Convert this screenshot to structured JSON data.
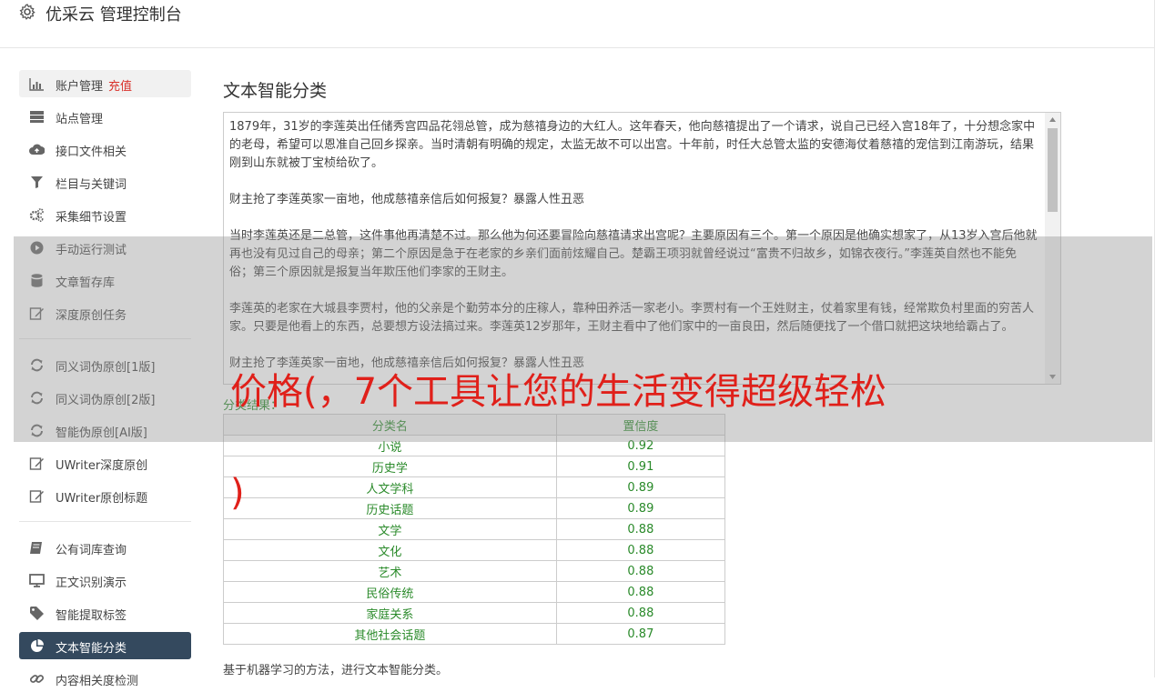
{
  "app": {
    "title": "优采云 管理控制台"
  },
  "sidebar": {
    "items": [
      {
        "label": "账户管理",
        "badge": "充值",
        "icon": "bar-chart-icon"
      },
      {
        "label": "站点管理",
        "icon": "server-icon"
      },
      {
        "label": "接口文件相关",
        "icon": "cloud-upload-icon"
      },
      {
        "label": "栏目与关键词",
        "icon": "filter-icon"
      },
      {
        "label": "采集细节设置",
        "icon": "gears-icon"
      },
      {
        "label": "手动运行测试",
        "icon": "play-circle-icon"
      },
      {
        "label": "文章暂存库",
        "icon": "database-icon"
      },
      {
        "label": "深度原创任务",
        "icon": "edit-icon"
      },
      {
        "label": "同义词伪原创[1版]",
        "icon": "refresh-icon"
      },
      {
        "label": "同义词伪原创[2版]",
        "icon": "refresh-icon"
      },
      {
        "label": "智能伪原创[AI版]",
        "icon": "refresh-icon"
      },
      {
        "label": "UWriter深度原创",
        "icon": "edit-icon"
      },
      {
        "label": "UWriter原创标题",
        "icon": "edit-icon"
      },
      {
        "label": "公有词库查询",
        "icon": "book-icon"
      },
      {
        "label": "正文识别演示",
        "icon": "monitor-icon"
      },
      {
        "label": "智能提取标签",
        "icon": "tag-icon"
      },
      {
        "label": "文本智能分类",
        "icon": "pie-chart-icon"
      },
      {
        "label": "内容相关度检测",
        "icon": "link-icon"
      }
    ]
  },
  "main": {
    "title": "文本智能分类",
    "text_paragraphs": [
      "1879年，31岁的李莲英出任储秀宫四品花翎总管，成为慈禧身边的大红人。这年春天，他向慈禧提出了一个请求，说自己已经入宫18年了，十分想念家中的老母，希望可以恩准自己回乡探亲。当时清朝有明确的规定，太监无故不可以出宫。十年前，时任大总管太监的安德海仗着慈禧的宠信到江南游玩，结果刚到山东就被丁宝桢给砍了。",
      "财主抢了李莲英家一亩地，他成慈禧亲信后如何报复？暴露人性丑恶",
      "当时李莲英还是二总管，这件事他再清楚不过。那么他为何还要冒险向慈禧请求出宫呢？主要原因有三个。第一个原因是他确实想家了，从13岁入宫后他就再也没有见过自己的母亲；第二个原因是急于在老家的乡亲们面前炫耀自己。楚霸王项羽就曾经说过“富贵不归故乡，如锦衣夜行。”李莲英自然也不能免俗；第三个原因就是报复当年欺压他们李家的王财主。",
      "李莲英的老家在大城县李贾村，他的父亲是个勤劳本分的庄稼人，靠种田养活一家老小。李贾村有一个王姓财主，仗着家里有钱，经常欺负村里面的穷苦人家。只要是他看上的东西，总要想方设法搞过来。李莲英12岁那年，王财主看中了他们家中的一亩良田，然后随便找了一个借口就把这块地给霸占了。",
      "财主抢了李莲英家一亩地，他成慈禧亲信后如何报复？暴露人性丑恶"
    ],
    "result_label": "分类结果：",
    "table": {
      "headers": [
        "分类名",
        "置信度"
      ],
      "rows": [
        [
          "小说",
          "0.92"
        ],
        [
          "历史学",
          "0.91"
        ],
        [
          "人文学科",
          "0.89"
        ],
        [
          "历史话题",
          "0.89"
        ],
        [
          "文学",
          "0.88"
        ],
        [
          "文化",
          "0.88"
        ],
        [
          "艺术",
          "0.88"
        ],
        [
          "民俗传统",
          "0.88"
        ],
        [
          "家庭关系",
          "0.88"
        ],
        [
          "其他社会话题",
          "0.87"
        ]
      ]
    },
    "footnote": "基于机器学习的方法，进行文本智能分类。"
  },
  "overlay": {
    "headline": "价格(，7个工具让您的生活变得超级轻松",
    "tail": ")"
  },
  "colors": {
    "active_nav": "#34495e",
    "result_green": "#2a8a2a",
    "overlay_red": "#e0201a",
    "badge_red": "#d9302a"
  }
}
